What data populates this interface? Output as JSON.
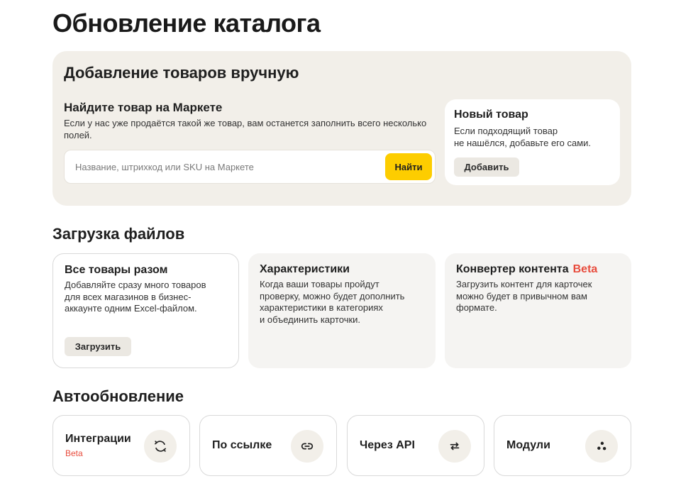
{
  "page": {
    "title": "Обновление каталога"
  },
  "manual": {
    "title": "Добавление товаров вручную",
    "find": {
      "title": "Найдите товар на Маркете",
      "description": "Если у нас уже продаётся такой же товар, вам останется заполнить всего несколько полей.",
      "search_placeholder": "Название, штрихкод или SKU на Маркете",
      "search_value": "",
      "button_label": "Найти"
    },
    "new_item": {
      "title": "Новый товар",
      "description_line1": "Если подходящий товар",
      "description_line2": "не нашёлся, добавьте его сами.",
      "button_label": "Добавить"
    }
  },
  "files": {
    "title": "Загрузка файлов",
    "cards": [
      {
        "title": "Все товары разом",
        "lines": [
          "Добавляйте сразу много товаров",
          "для всех магазинов в бизнес-",
          "аккаунте одним Excel-файлом."
        ],
        "button_label": "Загрузить"
      },
      {
        "title": "Характеристики",
        "lines": [
          "Когда ваши товары пройдут",
          "проверку, можно будет дополнить",
          "характеристики в категориях",
          "и объединить карточки."
        ]
      },
      {
        "title": "Конвертер контента",
        "badge": "Beta",
        "lines": [
          "Загрузить контент для карточек",
          "можно будет в привычном вам",
          "формате."
        ]
      }
    ]
  },
  "auto": {
    "title": "Автообновление",
    "cards": [
      {
        "label": "Интеграции",
        "badge": "Beta",
        "icon": "refresh-icon"
      },
      {
        "label": "По ссылке",
        "icon": "link-icon"
      },
      {
        "label": "Через API",
        "icon": "swap-arrows-icon"
      },
      {
        "label": "Модули",
        "icon": "modules-icon"
      }
    ]
  },
  "colors": {
    "accent_yellow": "#fdcd00",
    "beta_red": "#e84c3d",
    "panel_beige": "#f2efe9",
    "card_gray": "#f5f4f2"
  }
}
